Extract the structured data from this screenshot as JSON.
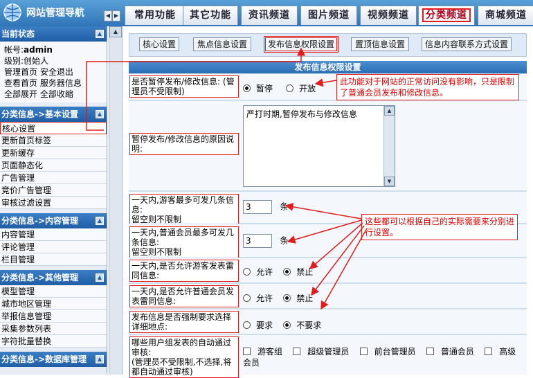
{
  "app": {
    "title": "网站管理导航"
  },
  "tabs": [
    {
      "label": "常用功能"
    },
    {
      "label": "其它功能"
    },
    {
      "label": "资讯频道"
    },
    {
      "label": "图片频道"
    },
    {
      "label": "视频频道"
    },
    {
      "label": "分类频道"
    },
    {
      "label": "商城频道"
    }
  ],
  "sidebar": {
    "status": {
      "title": "当前状态",
      "account_label": "帐号:",
      "account_value": "admin",
      "level_label": "级别:",
      "level_value": "创始人",
      "link_home": "管理首页",
      "link_logout": "安全退出",
      "link_view": "查看首页",
      "link_service": "服务器信息",
      "link_expand": "全部展开",
      "link_collapse": "全部收缩"
    },
    "sections": [
      {
        "title": "分类信息->基本设置",
        "items": [
          "核心设置",
          "更新首页标签",
          "更新缓存",
          "页面静态化",
          "广告管理",
          "竞价广告管理",
          "审核过滤设置"
        ]
      },
      {
        "title": "分类信息->内容管理",
        "items": [
          "内容管理",
          "评论管理",
          "栏目管理"
        ]
      },
      {
        "title": "分类信息->其他管理",
        "items": [
          "模型管理",
          "城市地区管理",
          "举报信息管理",
          "采集参数列表",
          "字符批量替换"
        ]
      },
      {
        "title": "分类信息->数据库管理",
        "items": []
      }
    ]
  },
  "subnav": [
    "核心设置",
    "焦点信息设置",
    "发布信息权限设置",
    "置顶信息设置",
    "信息内容联系方式设置"
  ],
  "form": {
    "title": "发布信息权限设置",
    "pause_label": "是否暂停发布/修改信息: (管理员不受限制)",
    "pause_opt1": "暂停",
    "pause_opt2": "开放",
    "reason_label": "暂停发布/修改信息的原因说明:",
    "reason_value": "严打时期,暂停发布与修改信息",
    "guest_limit_label": "一天内,游客最多可发几条信息:\n留空则不限制",
    "guest_limit_value": "3",
    "member_limit_label": "一天内,普通会员最多可发几条信息:\n留空则不限制",
    "member_limit_value": "3",
    "unit": "条",
    "guest_dup_label": "一天内,是否允许游客发表雷同信息:",
    "member_dup_label": "一天内,是否允许普通会员发表雷同信息:",
    "allow": "允许",
    "forbid": "禁止",
    "force_loc_label": "发布信息是否强制要求选择详细地点:",
    "require": "要求",
    "not_require": "不要求",
    "auto_label": "哪些用户组发表的自动通过审核:\n(管理员不受限制,不选择,将都自动通过审核)",
    "groups": [
      "游客组",
      "超级管理员",
      "前台管理员",
      "普通会员",
      "高级会员"
    ]
  },
  "notes": {
    "pause_note": "此功能对于网站的正常访问没有影响，只是限制了普通会员发布和修改信息。",
    "limit_note": "这些都可以根据自己的实际需要来分别进行设置。"
  },
  "colors": {
    "accent": "#2f74b8",
    "highlight": "#e21b1b"
  }
}
